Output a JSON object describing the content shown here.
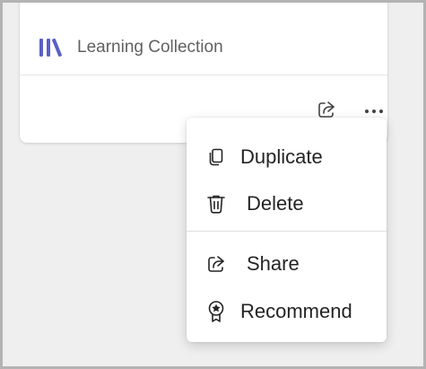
{
  "card": {
    "collection_label": "Learning Collection",
    "collection_icon": "library-icon",
    "accent_color": "#5b5fc7",
    "actions": {
      "share_icon": "share-icon",
      "more_icon": "more-options-icon"
    }
  },
  "menu": {
    "items": [
      {
        "label": "Duplicate",
        "icon": "duplicate-icon"
      },
      {
        "label": "Delete",
        "icon": "delete-icon"
      },
      {
        "label": "Share",
        "icon": "share-icon"
      },
      {
        "label": "Recommend",
        "icon": "recommend-icon"
      }
    ]
  }
}
